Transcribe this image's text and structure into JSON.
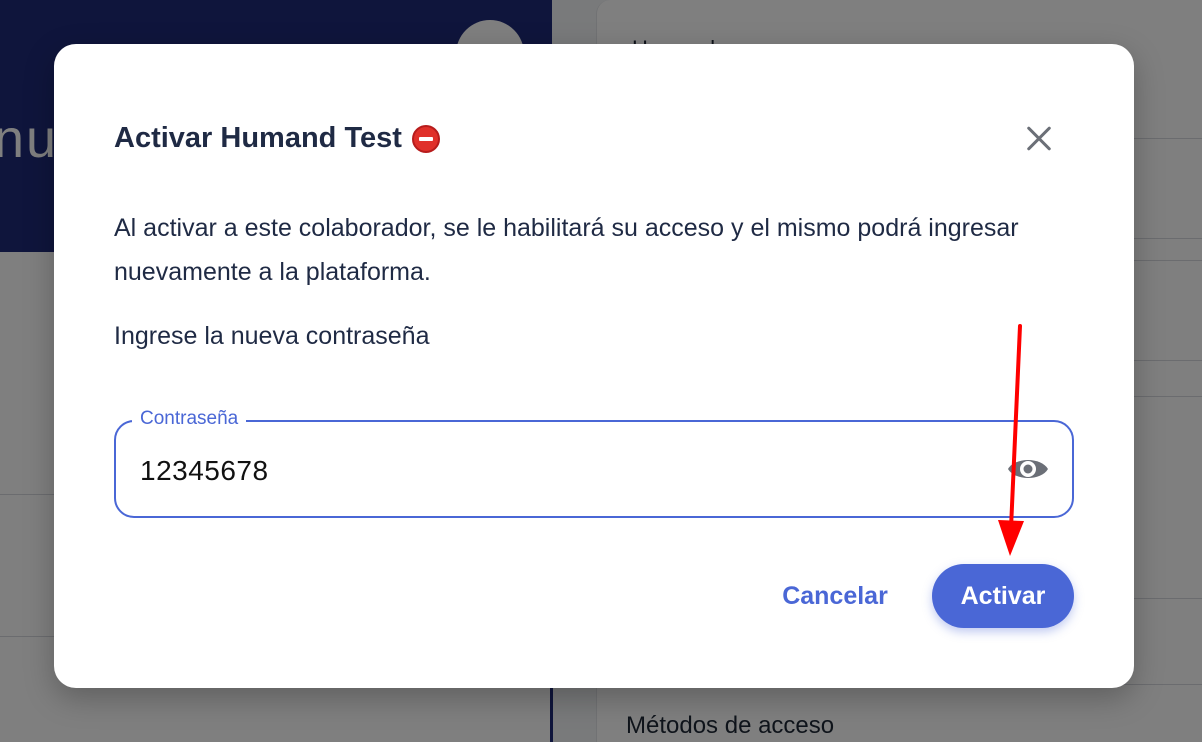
{
  "background": {
    "banner_text": "nu",
    "section_title": "Métodos de acceso",
    "faint_title": "Humand"
  },
  "modal": {
    "title": "Activar Humand Test",
    "title_icon": "no-entry-icon",
    "description": "Al activar a este colaborador, se le habilitará su acceso y el mismo podrá ingresar nuevamente a la plataforma.",
    "subtitle": "Ingrese la nueva contraseña",
    "password_field": {
      "label": "Contraseña",
      "value": "12345678",
      "toggle_icon": "eye-icon"
    },
    "cancel_label": "Cancelar",
    "activate_label": "Activar",
    "close_icon": "close-icon"
  },
  "colors": {
    "accent": "#4a67d6",
    "title_text": "#1f2a44",
    "banner": "#1e2a78",
    "annotation_arrow": "#ff0000"
  }
}
